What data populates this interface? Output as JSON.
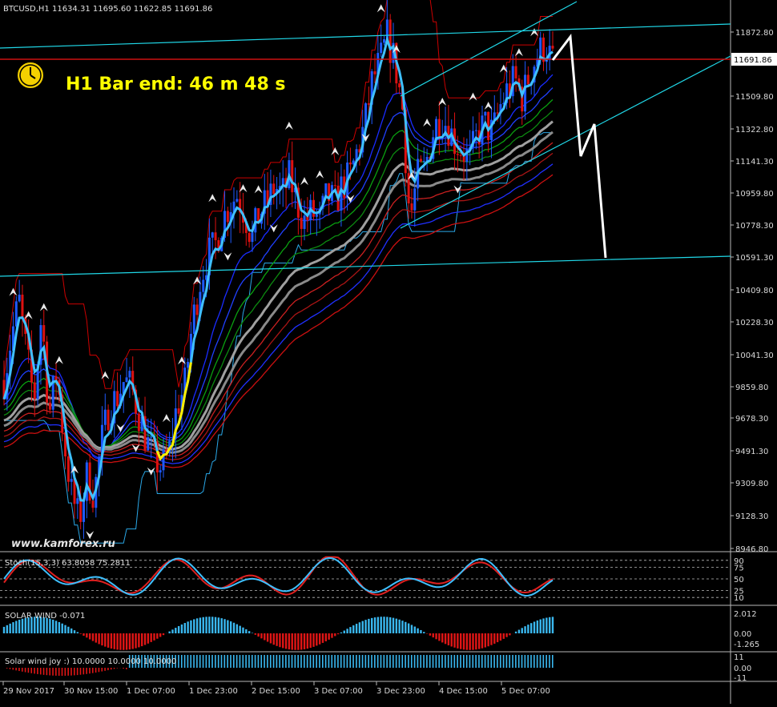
{
  "window": {
    "symbol_header": "BTCUSD,H1  11634.31 11695.60 11622.85 11691.86",
    "bar_timer": "H1 Bar end: 46 m 48 s",
    "watermark": "www.kamforex.ru",
    "price_tag": "11691.86"
  },
  "colors": {
    "background": "#000000",
    "bull": "#1e5aff",
    "bear": "#dd1111",
    "channel": "#00d0ff",
    "timer": "#ffff00",
    "signal_line": "#ffee00",
    "projection": "#ffffff"
  },
  "indicators": {
    "stoch_label": "Stoch(15,3,3) 63.8058 75.2811",
    "stoch_levels": [
      "90",
      "75",
      "50",
      "25",
      "10"
    ],
    "solar_label": "SOLAR WIND -0.071",
    "solar_levels": [
      "2.012",
      "0.00",
      "-1.265"
    ],
    "joy_label": "Solar wind joy :) 10.0000 10.0000 10.0000",
    "joy_levels": [
      "11",
      "0.00",
      "-11"
    ]
  },
  "chart_data": {
    "type": "candlestick",
    "title": "BTCUSD,H1",
    "ohlc_last": {
      "open": 11634.31,
      "high": 11695.6,
      "low": 11622.85,
      "close": 11691.86
    },
    "y_ticks": [
      "11872.80",
      "11691.86",
      "11509.80",
      "11322.80",
      "11141.30",
      "10959.80",
      "10778.30",
      "10591.30",
      "10409.80",
      "10228.30",
      "10041.30",
      "9859.80",
      "9678.30",
      "9491.30",
      "9309.80",
      "9128.30",
      "8946.80"
    ],
    "x_ticks": [
      "29 Nov 2017",
      "30 Nov 15:00",
      "1 Dec 07:00",
      "1 Dec 23:00",
      "2 Dec 15:00",
      "3 Dec 07:00",
      "3 Dec 23:00",
      "4 Dec 15:00",
      "5 Dec 07:00"
    ],
    "ylim": [
      8930,
      12020
    ],
    "close_path": [
      9900,
      10150,
      10350,
      10050,
      9780,
      10280,
      9700,
      9950,
      9550,
      9250,
      9100,
      9350,
      9250,
      9550,
      9750,
      9800,
      9900,
      9850,
      9700,
      9550,
      9450,
      9400,
      9500,
      9750,
      9850,
      10200,
      10450,
      10600,
      10650,
      10800,
      10900,
      10950,
      10850,
      10700,
      10850,
      10900,
      11000,
      10950,
      11050,
      10900,
      10800,
      10850,
      10800,
      10950,
      10900,
      11000,
      11050,
      11200,
      11350,
      11600,
      11700,
      11850,
      11700,
      11450,
      10800,
      11050,
      11100,
      11300,
      11400,
      11350,
      11250,
      11200,
      11150,
      11300,
      11350,
      11300,
      11450,
      11550,
      11600,
      11500,
      11650,
      11750,
      11800,
      11700
    ]
  }
}
